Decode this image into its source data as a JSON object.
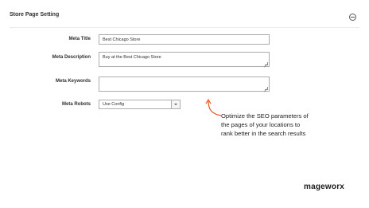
{
  "section": {
    "title": "Store Page Setting",
    "collapse_icon": "minus-circle-icon"
  },
  "fields": {
    "meta_title": {
      "label": "Meta Title",
      "value": "Best Chicago Store"
    },
    "meta_description": {
      "label": "Meta Description",
      "value": "Buy at the Best Chicago Store"
    },
    "meta_keywords": {
      "label": "Meta Keywords",
      "value": ""
    },
    "meta_robots": {
      "label": "Meta Robots",
      "value": "Use Config"
    }
  },
  "callout": {
    "line1": "Optimize the SEO parameters of",
    "line2": "the pages of your locations to",
    "line3": "rank better in the search results",
    "arrow_color": "#e8531f"
  },
  "brand": {
    "name": "mageworx"
  }
}
